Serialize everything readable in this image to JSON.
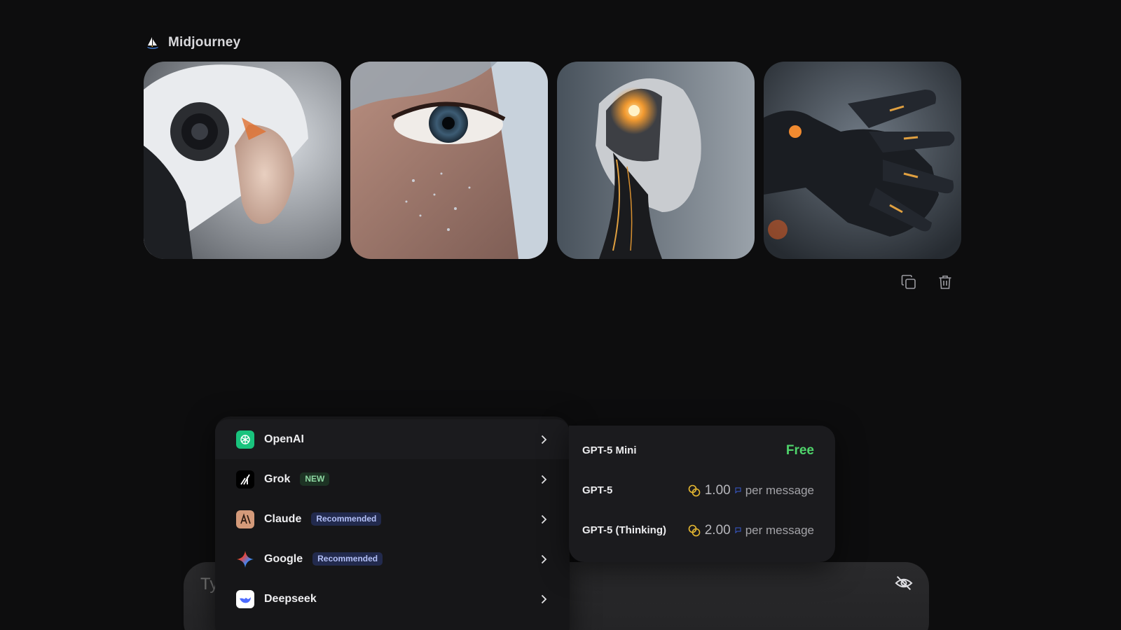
{
  "gallery": {
    "source_name": "Midjourney",
    "images": [
      {
        "name": "robot-helmet-woman-profile"
      },
      {
        "name": "eye-closeup-freckles"
      },
      {
        "name": "cyborg-glowing-head"
      },
      {
        "name": "robotic-hand"
      }
    ]
  },
  "actions": {
    "copy": "copy-icon",
    "delete": "trash-icon"
  },
  "composer": {
    "placeholder": "Ty"
  },
  "providers": [
    {
      "label": "OpenAI",
      "badge": "",
      "icon": "openai-icon"
    },
    {
      "label": "Grok",
      "badge": "NEW",
      "icon": "grok-icon"
    },
    {
      "label": "Claude",
      "badge": "Recommended",
      "icon": "claude-icon"
    },
    {
      "label": "Google",
      "badge": "Recommended",
      "icon": "google-icon"
    },
    {
      "label": "Deepseek",
      "badge": "",
      "icon": "deepseek-icon"
    }
  ],
  "models": [
    {
      "name": "GPT-5 Mini",
      "price": "Free"
    },
    {
      "name": "GPT-5",
      "amount": "1.00",
      "unit": "per message"
    },
    {
      "name": "GPT-5 (Thinking)",
      "amount": "2.00",
      "unit": "per message"
    }
  ],
  "colors": {
    "background": "#0d0d0e",
    "free": "#4fd46b",
    "coin": "#e6b830",
    "badge_new_bg": "#1d3324",
    "badge_rec_bg": "#222a4d"
  }
}
